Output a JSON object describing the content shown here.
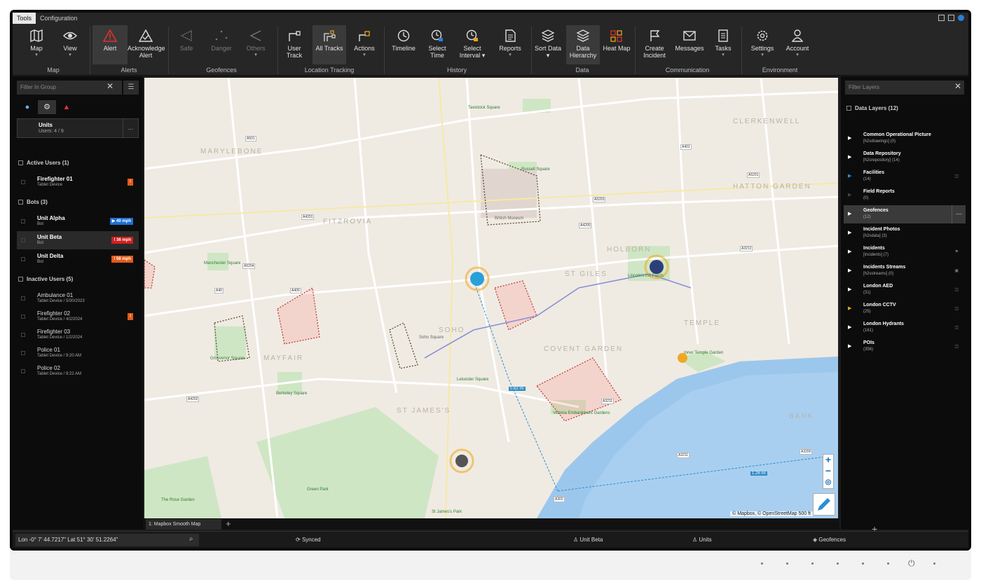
{
  "menu": {
    "tabs": [
      "Tools",
      "Configuration"
    ]
  },
  "ribbon": {
    "buttons": [
      {
        "label": "Map",
        "caret": "▾"
      },
      {
        "label": "View",
        "caret": "▾"
      },
      {
        "label": "Alert",
        "caret": ""
      },
      {
        "label": "Acknowledge Alert",
        "caret": ""
      },
      {
        "label": "Safe",
        "caret": ""
      },
      {
        "label": "Danger",
        "caret": ""
      },
      {
        "label": "Others",
        "caret": "▾"
      },
      {
        "label": "User Track",
        "caret": ""
      },
      {
        "label": "All Tracks",
        "caret": ""
      },
      {
        "label": "Actions",
        "caret": "▾"
      },
      {
        "label": "Timeline",
        "caret": ""
      },
      {
        "label": "Select Time",
        "caret": ""
      },
      {
        "label": "Select Interval ▾",
        "caret": ""
      },
      {
        "label": "Reports",
        "caret": "▾"
      },
      {
        "label": "Sort Data ▾",
        "caret": ""
      },
      {
        "label": "Data Hierarchy",
        "caret": ""
      },
      {
        "label": "Heat Map",
        "caret": ""
      },
      {
        "label": "Create Incident",
        "caret": ""
      },
      {
        "label": "Messages",
        "caret": ""
      },
      {
        "label": "Tasks",
        "caret": "▾"
      },
      {
        "label": "Settings",
        "caret": "▾"
      },
      {
        "label": "Account",
        "caret": "▾"
      }
    ],
    "groups": [
      "Map",
      "Alerts",
      "Geofences",
      "Location Tracking",
      "History",
      "Data",
      "Communication",
      "Environment"
    ]
  },
  "left_panel": {
    "filter_placeholder": "Filter In Group",
    "units": {
      "title": "Units",
      "subtitle": "Users: 4 / 9",
      "more": "..."
    },
    "groups": [
      {
        "title": "Active Users (1)"
      },
      {
        "title": "Bots (3)"
      },
      {
        "title": "Inactive Users (5)"
      }
    ],
    "rows": [
      {
        "name": "Firefighter 01",
        "sub": "Tablet Device",
        "badge": "!",
        "badge_color": "#e05a1a"
      },
      {
        "name": "Unit Alpha",
        "sub": "Bot",
        "badge": "▶ 40 mph",
        "badge_color": "#1f6fd1"
      },
      {
        "name": "Unit Beta",
        "sub": "Bot",
        "badge": "! 36 mph",
        "badge_color": "#d11f1f"
      },
      {
        "name": "Unit Delta",
        "sub": "Bot",
        "badge": "! 56 mph",
        "badge_color": "#e05a1a"
      },
      {
        "name": "Ambulance 01",
        "sub": "Tablet Device / 5/30/2023",
        "badge": "",
        "badge_color": ""
      },
      {
        "name": "Firefighter 02",
        "sub": "Tablet Device / 4/2/2024",
        "badge": "!",
        "badge_color": "#e05a1a"
      },
      {
        "name": "Firefighter 03",
        "sub": "Tablet Device / 1/2/2024",
        "badge": "",
        "badge_color": ""
      },
      {
        "name": "Police 01",
        "sub": "Tablet Device / 9:20 AM",
        "badge": "",
        "badge_color": ""
      },
      {
        "name": "Police 02",
        "sub": "Tablet Device / 9:22 AM",
        "badge": "",
        "badge_color": ""
      }
    ]
  },
  "map": {
    "tab_label": "1: Mapbox Smooth Map",
    "attribution": "© Mapbox, © OpenStreetMap  500 ft",
    "areas": [
      "MARYLEBONE",
      "FITZROVIA",
      "MAYFAIR",
      "SOHO",
      "COVENT GARDEN",
      "ST GILES",
      "HOLBORN",
      "CLERKENWELL",
      "HATTON GARDEN",
      "TEMPLE",
      "BANK",
      "ST JAMES'S"
    ],
    "places": [
      "Tavistock Square",
      "Russell Square",
      "Manchester Square",
      "Grosvenor Square",
      "Berkeley Square",
      "Leicester Square",
      "Victoria Embankment Gardens",
      "Lincoln's Inn Fields",
      "Inner Temple Garden",
      "Green Park",
      "The Rose Garden",
      "St James's Park",
      "British Museum",
      "Soho Square"
    ],
    "roads": [
      "A501",
      "A5204",
      "A4201",
      "A400",
      "A40",
      "A5203",
      "A4200",
      "A401",
      "A5201",
      "A3211",
      "A302",
      "A4202",
      "A3212",
      "A3200",
      "A3211"
    ],
    "distance_label": "0.62 mi",
    "distance_label_2": "1.26 mi"
  },
  "right_panel": {
    "filter_placeholder": "Filter Layers",
    "head": "Data Layers (12)",
    "layers": [
      {
        "name": "Common Operational Picture",
        "sub": "[h2sdrawings] (0)"
      },
      {
        "name": "Data Repository",
        "sub": "[h2srepository] (14)"
      },
      {
        "name": "Facilities",
        "sub": "(14)"
      },
      {
        "name": "Field Reports",
        "sub": "(0)"
      },
      {
        "name": "Geofences",
        "sub": "(12)"
      },
      {
        "name": "Incident Photos",
        "sub": "[h2sdata] (3)"
      },
      {
        "name": "Incidents",
        "sub": "[incidents] (7)"
      },
      {
        "name": "Incidents Streams",
        "sub": "[h2sstreams] (0)"
      },
      {
        "name": "London AED",
        "sub": "(31)"
      },
      {
        "name": "London CCTV",
        "sub": "(25)"
      },
      {
        "name": "London Hydrants",
        "sub": "(161)"
      },
      {
        "name": "POIs",
        "sub": "(356)"
      }
    ]
  },
  "status": {
    "coords": "Lon -0° 7' 44.7217\" Lat 51° 30' 51.2264\"",
    "synced": "Synced",
    "unit": "Unit Beta",
    "units": "Units",
    "geofences": "Geofences"
  }
}
